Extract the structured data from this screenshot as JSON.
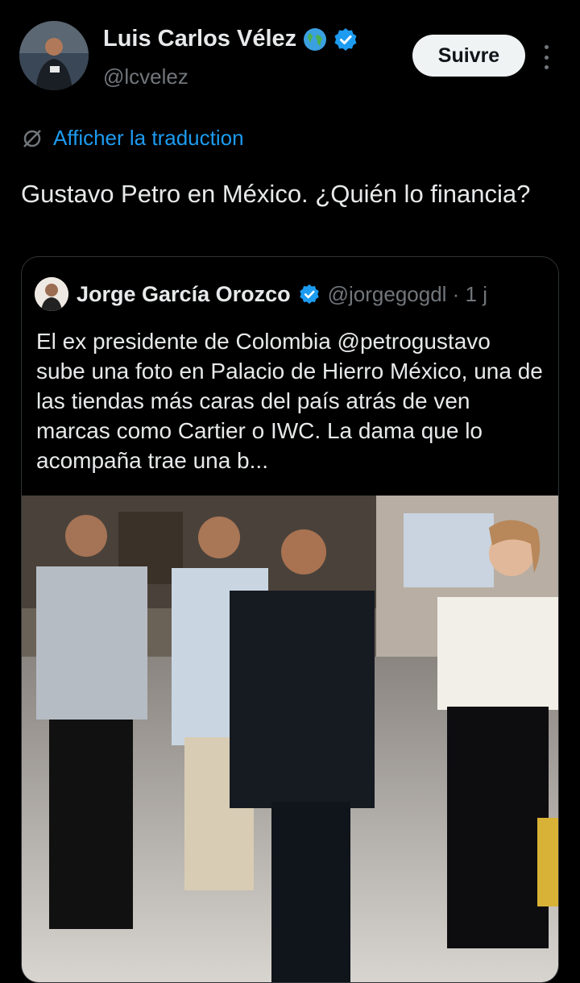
{
  "author": {
    "name": "Luis Carlos Vélez",
    "handle": "@lcvelez",
    "globe_icon": "globe-emoji",
    "verified_icon": "verified-badge"
  },
  "follow_label": "Suivre",
  "translate_label": "Afficher la traduction",
  "tweet_text": "Gustavo Petro en México. ¿Quién lo financia?",
  "quoted": {
    "name": "Jorge García Orozco",
    "handle_time": "@jorgegogdl · 1 j",
    "text": "El ex presidente de Colombia @petrogustavo sube una foto en Palacio de Hierro México, una de las tiendas más caras del país atrás de ven marcas como Cartier o IWC. La dama que lo acompaña  trae una b..."
  },
  "colors": {
    "accent": "#1d9bf0",
    "background": "#000000",
    "muted": "#71767b"
  }
}
